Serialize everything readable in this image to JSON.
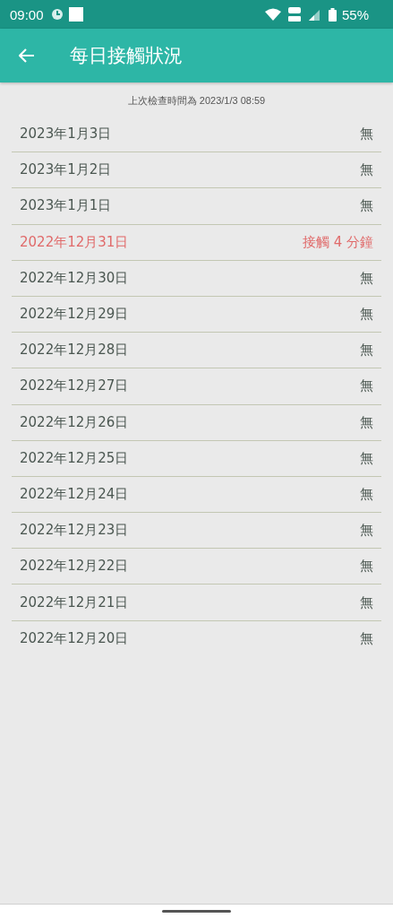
{
  "status_bar": {
    "time": "09:00",
    "battery": "55%"
  },
  "app_bar": {
    "title": "每日接觸狀況"
  },
  "last_check": "上次檢查時間為 2023/1/3 08:59",
  "days": [
    {
      "date": "2023年1月3日",
      "result": "無",
      "alert": false
    },
    {
      "date": "2023年1月2日",
      "result": "無",
      "alert": false
    },
    {
      "date": "2023年1月1日",
      "result": "無",
      "alert": false
    },
    {
      "date": "2022年12月31日",
      "result": "接觸 4 分鐘",
      "alert": true
    },
    {
      "date": "2022年12月30日",
      "result": "無",
      "alert": false
    },
    {
      "date": "2022年12月29日",
      "result": "無",
      "alert": false
    },
    {
      "date": "2022年12月28日",
      "result": "無",
      "alert": false
    },
    {
      "date": "2022年12月27日",
      "result": "無",
      "alert": false
    },
    {
      "date": "2022年12月26日",
      "result": "無",
      "alert": false
    },
    {
      "date": "2022年12月25日",
      "result": "無",
      "alert": false
    },
    {
      "date": "2022年12月24日",
      "result": "無",
      "alert": false
    },
    {
      "date": "2022年12月23日",
      "result": "無",
      "alert": false
    },
    {
      "date": "2022年12月22日",
      "result": "無",
      "alert": false
    },
    {
      "date": "2022年12月21日",
      "result": "無",
      "alert": false
    },
    {
      "date": "2022年12月20日",
      "result": "無",
      "alert": false
    }
  ]
}
